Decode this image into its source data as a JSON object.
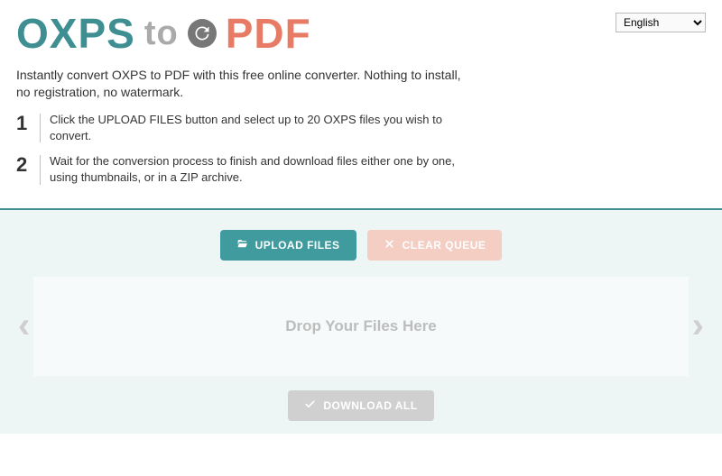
{
  "logo": {
    "word1": "OXPS",
    "word2": "to",
    "word3": "PDF"
  },
  "language": {
    "selected": "English",
    "options": [
      "English"
    ]
  },
  "description": "Instantly convert OXPS to PDF with this free online converter. Nothing to install, no registration, no watermark.",
  "steps": [
    {
      "num": "1",
      "text": "Click the UPLOAD FILES button and select up to 20 OXPS files you wish to convert."
    },
    {
      "num": "2",
      "text": "Wait for the conversion process to finish and download files either one by one, using thumbnails, or in a ZIP archive."
    }
  ],
  "buttons": {
    "upload": "UPLOAD FILES",
    "clear": "CLEAR QUEUE",
    "download": "DOWNLOAD ALL"
  },
  "drop_text": "Drop Your Files Here",
  "nav": {
    "prev": "‹",
    "next": "›"
  }
}
